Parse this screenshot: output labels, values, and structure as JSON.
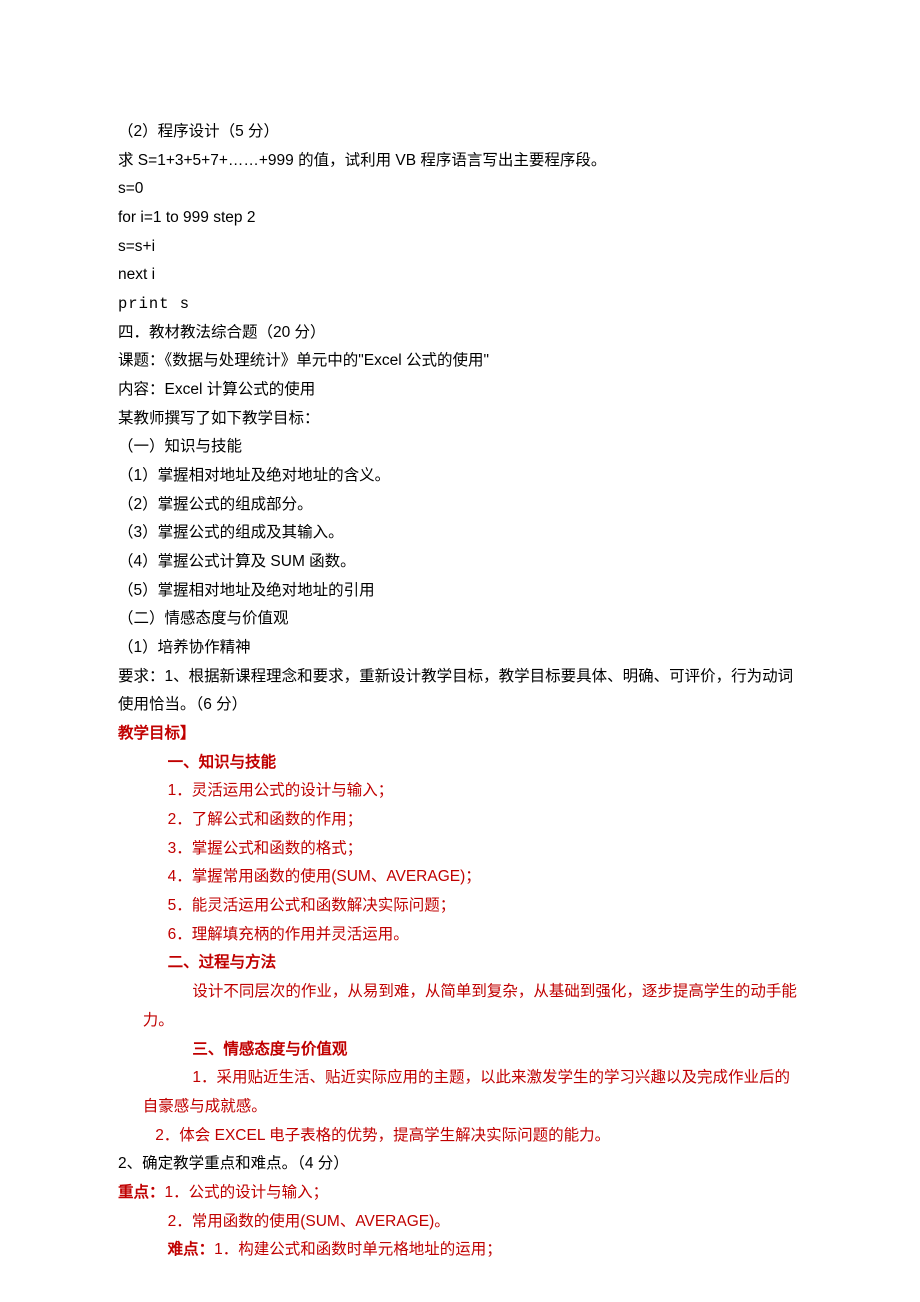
{
  "lines": {
    "l1": "（2）程序设计（5 分）",
    "l2": "求 S=1+3+5+7+……+999 的值，试利用 VB 程序语言写出主要程序段。",
    "l3": "s=0",
    "l4": "for i=1 to 999 step 2",
    "l5": "s=s+i",
    "l6": "next i",
    "l7": "print  s",
    "l8": "四．教材教法综合题（20 分）",
    "l9": "课题：《数据与处理统计》单元中的\"Excel 公式的使用\"",
    "l10": "内容：Excel 计算公式的使用",
    "l11": "某教师撰写了如下教学目标：",
    "l12": "（一）知识与技能",
    "l13": "（1）掌握相对地址及绝对地址的含义。",
    "l14": "（2）掌握公式的组成部分。",
    "l15": "（3）掌握公式的组成及其输入。",
    "l16": "（4）掌握公式计算及 SUM 函数。",
    "l17": "（5）掌握相对地址及绝对地址的引用",
    "l18": "（二）情感态度与价值观",
    "l19": "（1）培养协作精神",
    "l20": "要求：1、根据新课程理念和要求，重新设计教学目标，教学目标要具体、明确、可评价，行为动词使用恰当。（6 分）",
    "l21": "教学目标】",
    "l22": "一、知识与技能",
    "l23": "1．灵活运用公式的设计与输入；",
    "l24": "2．了解公式和函数的作用；",
    "l25": "3．掌握公式和函数的格式；",
    "l26": "4．掌握常用函数的使用(SUM、AVERAGE)；",
    "l27": "5．能灵活运用公式和函数解决实际问题；",
    "l28": "6．理解填充柄的作用并灵活运用。",
    "l29": "二、过程与方法",
    "l30": "设计不同层次的作业，从易到难，从简单到复杂，从基础到强化，逐步提高学生的动手能力。",
    "l31": "三、情感态度与价值观",
    "l32": "1．采用贴近生活、贴近实际应用的主题，以此来激发学生的学习兴趣以及完成作业后的自豪感与成就感。",
    "l33": "2．体会 EXCEL 电子表格的优势，提高学生解决实际问题的能力。",
    "l34a": "2、确定教学重点和难点。（4 分）",
    "l35a": "重点：",
    "l35b": "1．公式的设计与输入；",
    "l36": "2．常用函数的使用(SUM、AVERAGE)。",
    "l37a": "难点：",
    "l37b": "1．构建公式和函数时单元格地址的运用；"
  }
}
